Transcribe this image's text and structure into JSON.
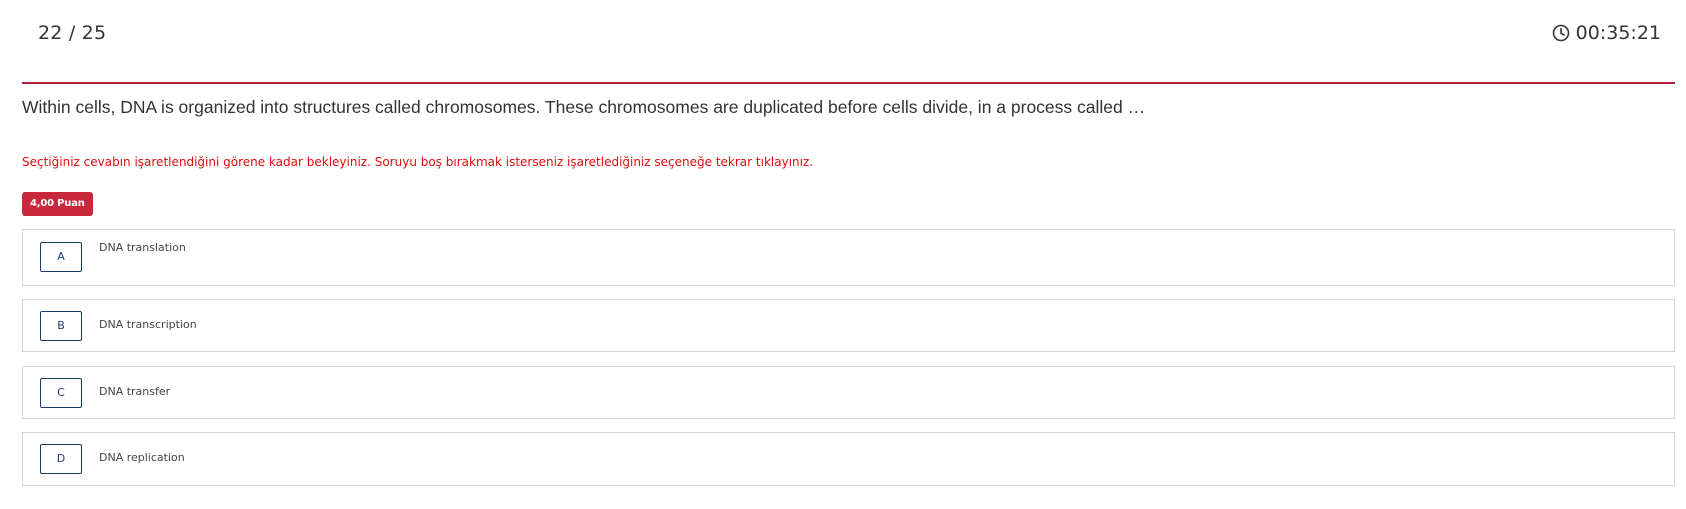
{
  "header": {
    "counter": "22 / 25",
    "timer": "00:35:21"
  },
  "question": {
    "text": "Within cells, DNA is organized into structures called chromosomes. These chromosomes are duplicated before cells divide, in a process called …",
    "warning": "Seçtiğiniz cevabın işaretlendiğini görene kadar bekleyiniz. Soruyu boş bırakmak isterseniz işaretlediğiniz seçeneğe tekrar tıklayınız.",
    "points": "4,00 Puan"
  },
  "options": [
    {
      "letter": "A",
      "text": "DNA translation"
    },
    {
      "letter": "B",
      "text": "DNA transcription"
    },
    {
      "letter": "C",
      "text": "DNA transfer"
    },
    {
      "letter": "D",
      "text": "DNA replication"
    }
  ],
  "colors": {
    "accent": "#b31b3b",
    "badge": "#c8283b",
    "warning": "#e00b0b",
    "letter_border": "#1a3c6c"
  }
}
